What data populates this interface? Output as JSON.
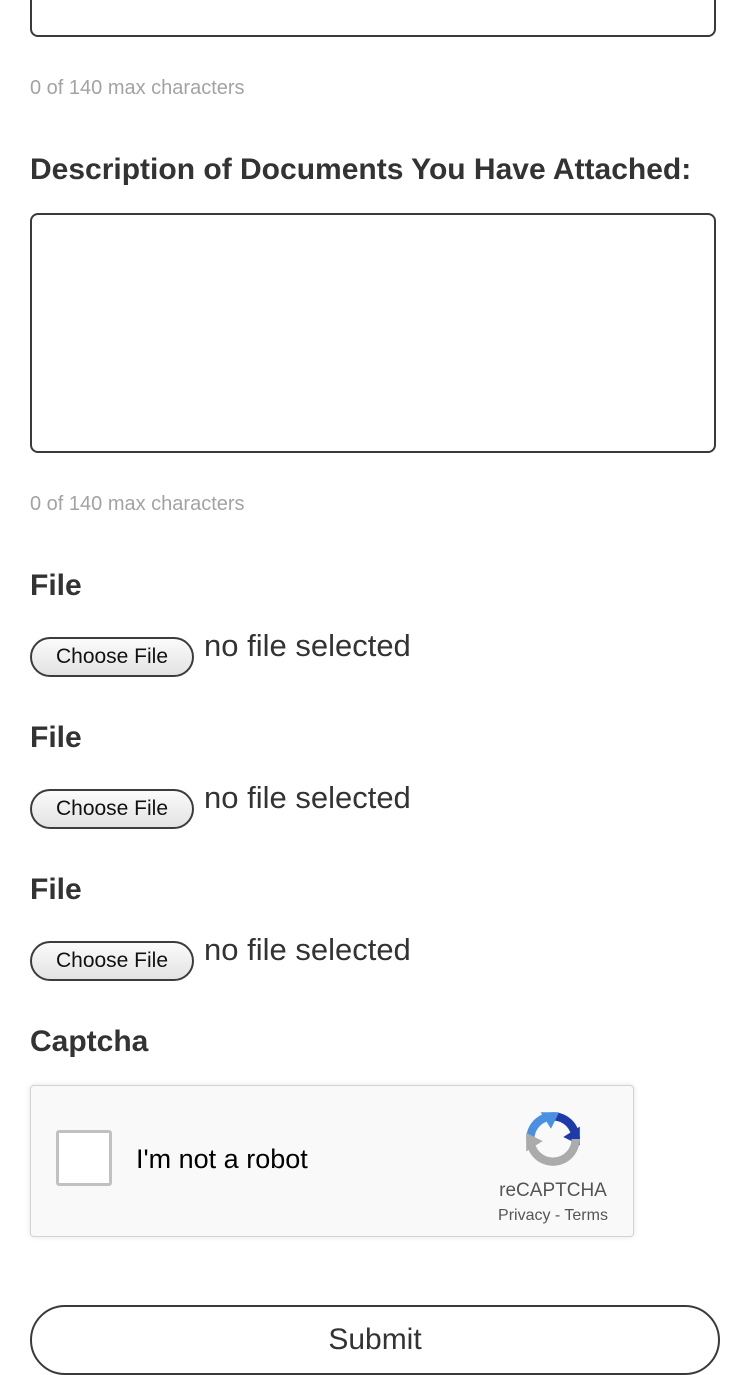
{
  "previous_field": {
    "value": "",
    "counter": "0 of 140 max characters"
  },
  "description_field": {
    "label": "Description of Documents You Have Attached:",
    "value": "",
    "counter": "0 of 140 max characters"
  },
  "file_uploads": [
    {
      "label": "File",
      "button_label": "Choose File",
      "status": "no file selected"
    },
    {
      "label": "File",
      "button_label": "Choose File",
      "status": "no file selected"
    },
    {
      "label": "File",
      "button_label": "Choose File",
      "status": "no file selected"
    }
  ],
  "captcha": {
    "heading": "Captcha",
    "checkbox_label": "I'm not a robot",
    "brand": "reCAPTCHA",
    "privacy_link": "Privacy",
    "separator": " - ",
    "terms_link": "Terms",
    "icon": "recaptcha-logo-icon"
  },
  "submit": {
    "label": "Submit"
  },
  "colors": {
    "text": "#333333",
    "muted": "#a3a3a3",
    "border": "#3a3a3a",
    "captcha_blue": "#1c3aa9",
    "captcha_light_blue": "#4a90e2",
    "captcha_grey": "#ababab"
  }
}
